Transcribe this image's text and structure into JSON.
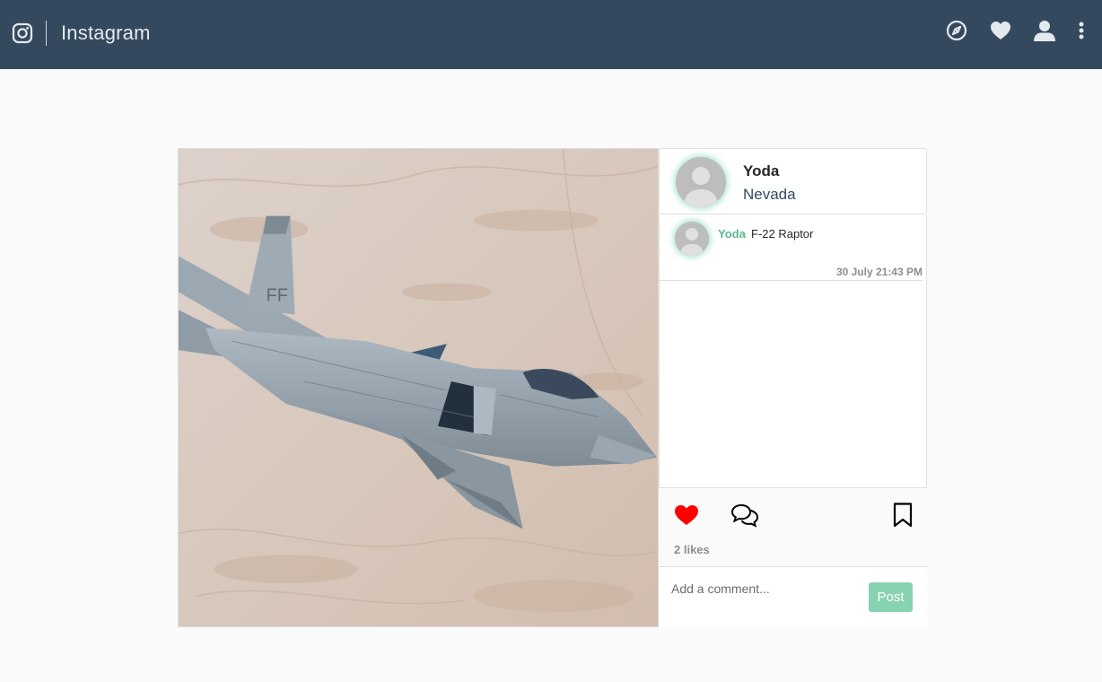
{
  "navbar": {
    "brand": "Instagram",
    "icons": [
      "instagram-logo-icon",
      "compass-icon",
      "heart-icon",
      "user-icon",
      "more-vertical-icon"
    ]
  },
  "post": {
    "image_alt": "F-22 Raptor",
    "author": {
      "username": "Yoda",
      "location": "Nevada"
    },
    "caption": {
      "username": "Yoda",
      "text": "F-22 Raptor",
      "timestamp": "30 July 21:43 PM"
    },
    "actions": {
      "liked": true,
      "likes_text": "2 likes"
    },
    "comment": {
      "placeholder": "Add a comment...",
      "value": "",
      "post_label": "Post"
    }
  },
  "colors": {
    "navbar": "#34495e",
    "accent": "#5cb88d",
    "like": "#ff0000",
    "post_button": "#86d2b1"
  }
}
